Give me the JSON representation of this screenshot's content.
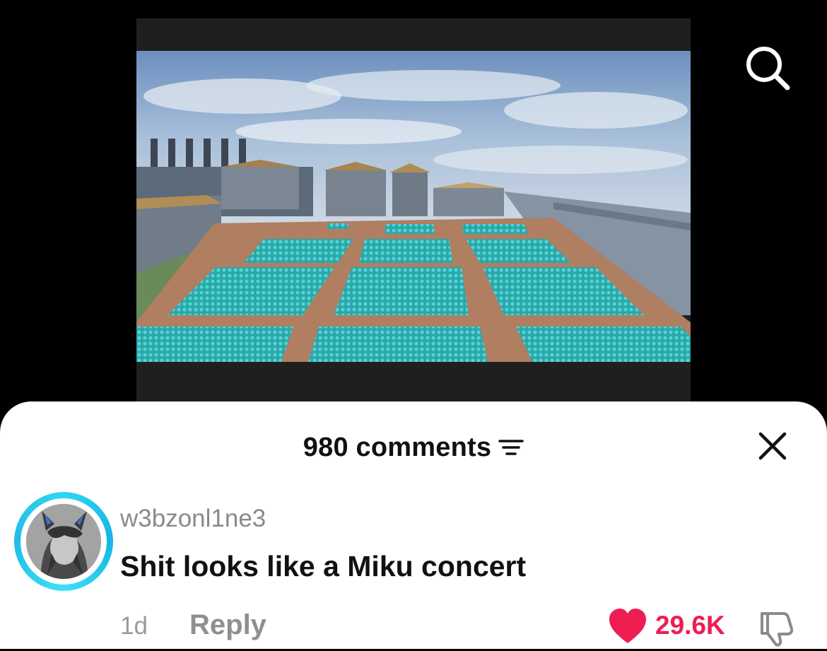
{
  "video": {
    "scene_icon": "minecraft-crowd-scene"
  },
  "icons": {
    "search": "search-icon",
    "sort": "sort-filter-icon",
    "close": "close-icon",
    "like": "heart-icon",
    "dislike": "thumbs-down-icon"
  },
  "comments_sheet": {
    "title": "980 comments"
  },
  "comment": {
    "username": "w3bzonl1ne3",
    "text": "Shit looks like a Miku concert",
    "time_ago": "1d",
    "reply_label": "Reply",
    "like_count": "29.6K"
  },
  "colors": {
    "like_accent": "#ee1d52",
    "avatar_ring": "#2fd6ef"
  }
}
